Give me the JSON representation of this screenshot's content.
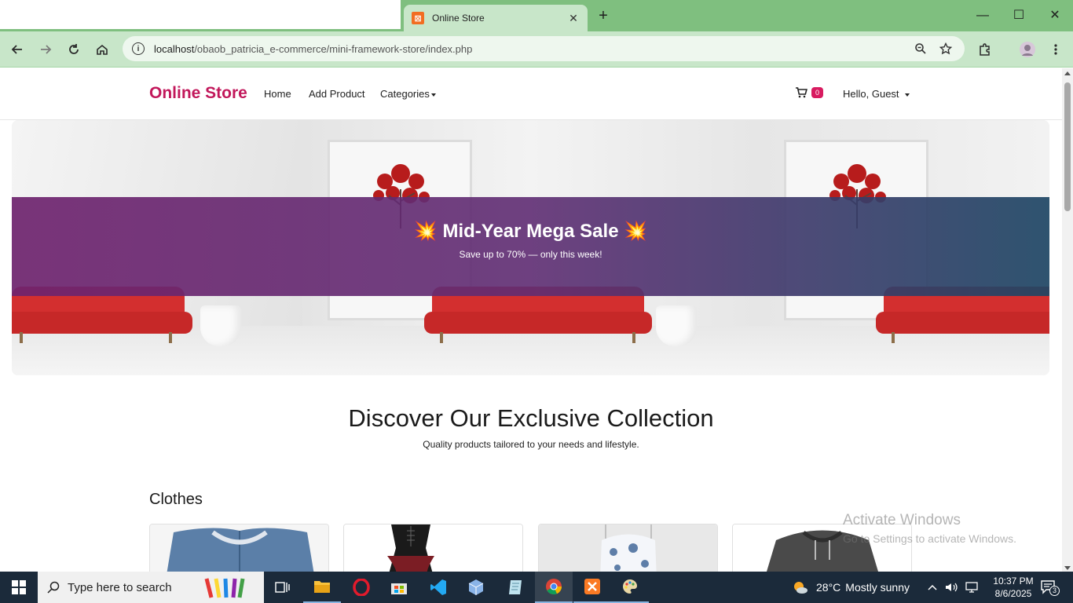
{
  "browser": {
    "tab_title": "Online Store",
    "url_host": "localhost",
    "url_path": "/obaob_patricia_e-commerce/mini-framework-store/index.php"
  },
  "navbar": {
    "brand": "Online Store",
    "links": [
      "Home",
      "Add Product",
      "Categories"
    ],
    "cart_count": "0",
    "user_menu": "Hello, Guest"
  },
  "hero": {
    "sale_title": "💥 Mid-Year Mega Sale 💥",
    "sale_subtitle": "Save up to 70% — only this week!"
  },
  "collection": {
    "title": "Discover Our Exclusive Collection",
    "subtitle": "Quality products tailored to your needs and lifestyle."
  },
  "category": {
    "heading": "Clothes",
    "products": [
      "denim-jacket-image",
      "corset-dress-image",
      "floral-top-image",
      "gray-hoodie-image"
    ]
  },
  "watermark": {
    "line1": "Activate Windows",
    "line2": "Go to Settings to activate Windows."
  },
  "taskbar": {
    "search_placeholder": "Type here to search",
    "weather_temp": "28°C",
    "weather_text": "Mostly sunny",
    "time": "10:37 PM",
    "date": "8/6/2025",
    "notification_count": "3"
  },
  "colors": {
    "brand": "#c2185b",
    "tabstrip": "#7fbf7f",
    "toolbar": "#c8e6c9",
    "banner_start": "#6e236e",
    "banner_end": "#1e4664",
    "cart_badge": "#d81b60"
  }
}
